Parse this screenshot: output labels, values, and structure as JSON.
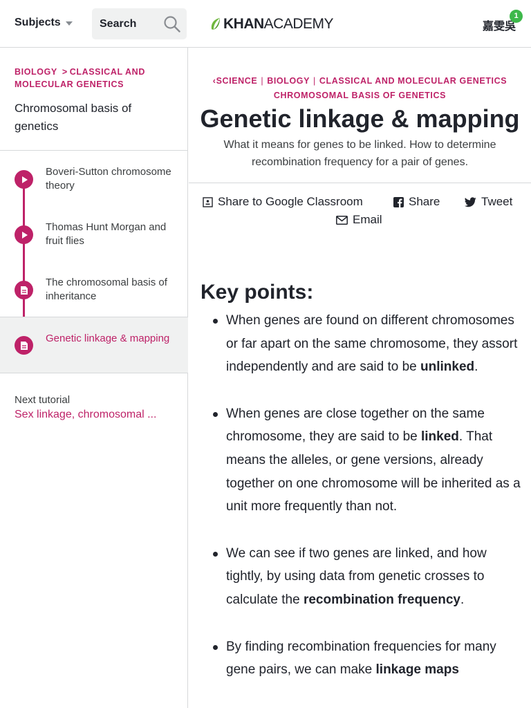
{
  "header": {
    "subjects_label": "Subjects",
    "search_label": "Search",
    "logo_bold": "KHAN",
    "logo_light": "ACADEMY",
    "user_name": "嘉雯吳",
    "notification_count": "1"
  },
  "sidebar": {
    "breadcrumb": {
      "part1": "BIOLOGY",
      "separator": ">",
      "part2": "CLASSICAL AND MOLECULAR GENETICS"
    },
    "unit_title": "Chromosomal basis of genetics",
    "lessons": [
      {
        "title": "Boveri-Sutton chromosome theory",
        "icon": "play-icon"
      },
      {
        "title": "Thomas Hunt Morgan and fruit flies",
        "icon": "play-icon"
      },
      {
        "title": "The chromosomal basis of inheritance",
        "icon": "article-icon"
      },
      {
        "title": "Genetic linkage & mapping",
        "icon": "article-icon",
        "active": true
      }
    ],
    "next_label": "Next tutorial",
    "next_link": "Sex linkage, chromosomal ..."
  },
  "main": {
    "breadcrumb": {
      "back": "SCIENCE",
      "items": [
        "BIOLOGY",
        "CLASSICAL AND MOLECULAR GENETICS",
        "CHROMOSOMAL BASIS OF GENETICS"
      ],
      "separator": "|"
    },
    "title": "Genetic linkage & mapping",
    "subtitle": "What it means for genes to be linked. How to determine recombination frequency for a pair of genes.",
    "share": {
      "classroom": "Share to Google Classroom",
      "facebook": "Share",
      "tweet": "Tweet",
      "email": "Email"
    },
    "key_points_heading": "Key points:",
    "key_points": [
      {
        "before": "When genes are found on different chromosomes or far apart on the same chromosome, they assort independently and are said to be ",
        "bold": "unlinked",
        "after": "."
      },
      {
        "before": "When genes are close together on the same chromosome, they are said to be ",
        "bold": "linked",
        "after": ". That means the alleles, or gene versions, already together on one chromosome will be inherited as a unit more frequently than not."
      },
      {
        "before": "We can see if two genes are linked, and how tightly, by using data from genetic crosses to calculate the ",
        "bold": "recombination frequency",
        "after": "."
      },
      {
        "before": "By finding recombination frequencies for many gene pairs, we can make ",
        "bold": "linkage maps",
        "after": ""
      }
    ]
  },
  "colors": {
    "accent": "#be2268",
    "logo_leaf": "#6fb73d",
    "notification": "#3db84a",
    "text": "#21242c"
  }
}
